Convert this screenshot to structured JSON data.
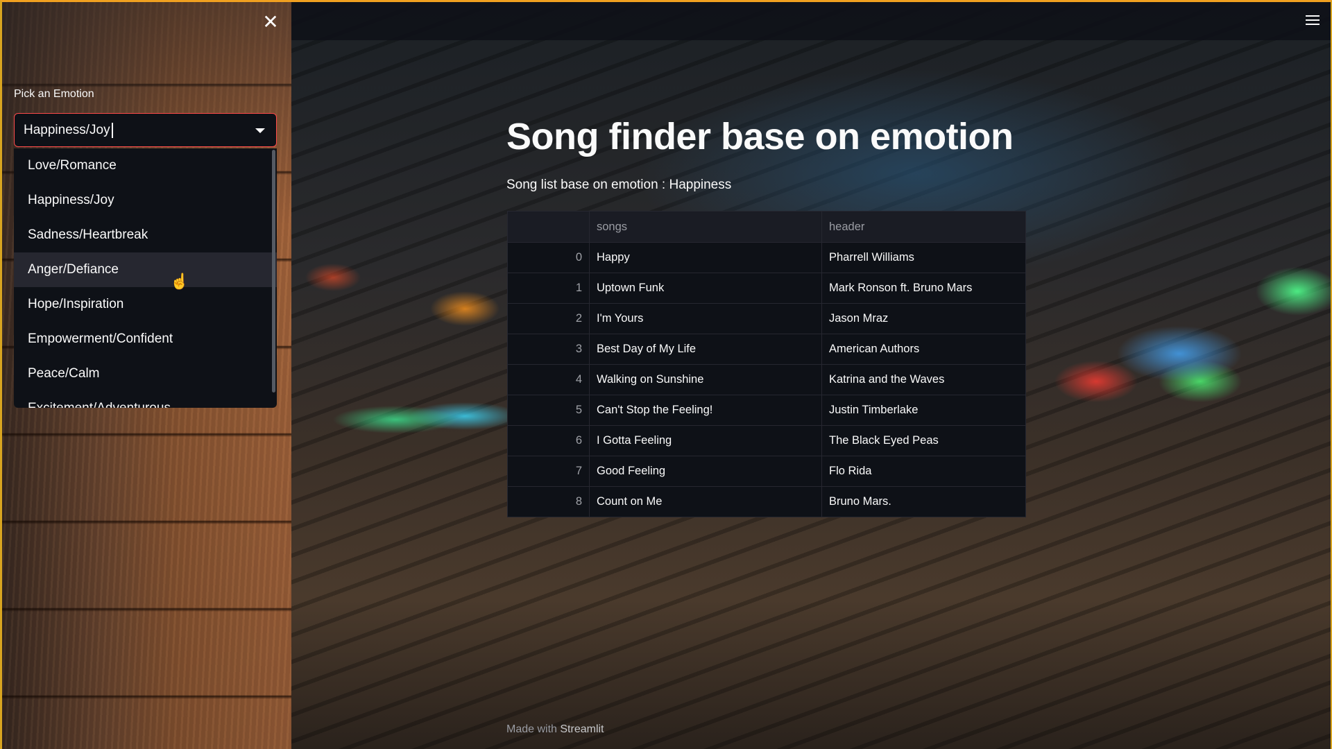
{
  "sidebar": {
    "close_icon": "close-icon",
    "label": "Pick an Emotion",
    "selected_value": "Happiness/Joy",
    "options": [
      "Love/Romance",
      "Happiness/Joy",
      "Sadness/Heartbreak",
      "Anger/Defiance",
      "Hope/Inspiration",
      "Empowerment/Confident",
      "Peace/Calm",
      "Excitement/Adventurous"
    ],
    "hovered_option": "Anger/Defiance"
  },
  "header": {
    "menu_icon": "hamburger-menu-icon"
  },
  "main": {
    "title": "Song finder base on emotion",
    "subtitle": "Song list base on emotion : Happiness",
    "table": {
      "columns": [
        "",
        "songs",
        "header"
      ],
      "rows": [
        {
          "index": "0",
          "song": "Happy",
          "artist": "Pharrell Williams"
        },
        {
          "index": "1",
          "song": "Uptown Funk",
          "artist": "Mark Ronson ft. Bruno Mars"
        },
        {
          "index": "2",
          "song": "I'm Yours",
          "artist": "Jason Mraz"
        },
        {
          "index": "3",
          "song": "Best Day of My Life",
          "artist": "American Authors"
        },
        {
          "index": "4",
          "song": "Walking on Sunshine",
          "artist": "Katrina and the Waves"
        },
        {
          "index": "5",
          "song": "Can't Stop the Feeling!",
          "artist": "Justin Timberlake"
        },
        {
          "index": "6",
          "song": "I Gotta Feeling",
          "artist": "The Black Eyed Peas"
        },
        {
          "index": "7",
          "song": "Good Feeling",
          "artist": "Flo Rida"
        },
        {
          "index": "8",
          "song": "Count on Me",
          "artist": "Bruno Mars."
        }
      ]
    }
  },
  "footer": {
    "prefix": "Made with ",
    "brand": "Streamlit"
  },
  "colors": {
    "accent": "#ff4b4b",
    "background": "#0e1117"
  }
}
